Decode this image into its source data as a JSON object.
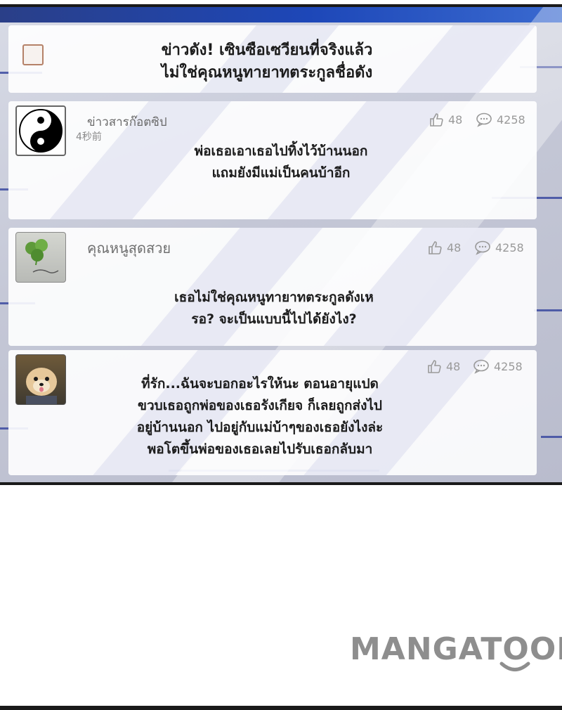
{
  "header": {
    "headline_line1": "ข่าวดัง! เซินซือเซวียนที่จริงแล้ว",
    "headline_line2": "ไม่ใช่คุณหนูทายาทตระกูลชื่อดัง"
  },
  "posts": [
    {
      "username": "ข่าวสารก๊อตซิป",
      "time": "4秒前",
      "likes": "48",
      "comments": "4258",
      "avatar": "yin-yang",
      "lines": [
        "พ่อเธอเอาเธอไปทิ้งไว้บ้านนอก",
        "แถมยังมีแม่เป็นคนบ้าอีก"
      ]
    },
    {
      "username": "คุณหนูสุดสวย",
      "likes": "48",
      "comments": "4258",
      "avatar": "clover-sketch",
      "lines": [
        "เธอไม่ใช่คุณหนูทายาทตระกูลดังเห",
        "รอ? จะเป็นแบบนี้ไปได้ยังไง?"
      ]
    },
    {
      "likes": "48",
      "comments": "4258",
      "avatar": "puppy-photo",
      "lines": [
        "ที่รัก...ฉันจะบอกอะไรให้นะ ตอนอายุแปด",
        "ขวบเธอถูกพ่อของเธอรังเกียจ ก็เลยถูกส่งไป",
        "อยู่บ้านนอก ไปอยู่กับแม่บ้าๆของเธอยังไงล่ะ",
        "พอโตขึ้นพ่อของเธอเลยไปรับเธอกลับมา"
      ]
    }
  ],
  "watermark": {
    "text": "MANGATOON",
    "color": "#8e8e8e"
  },
  "colors": {
    "accent": "#1d47b8",
    "text": "#1c1c1c",
    "muted": "#9a9a9a"
  }
}
